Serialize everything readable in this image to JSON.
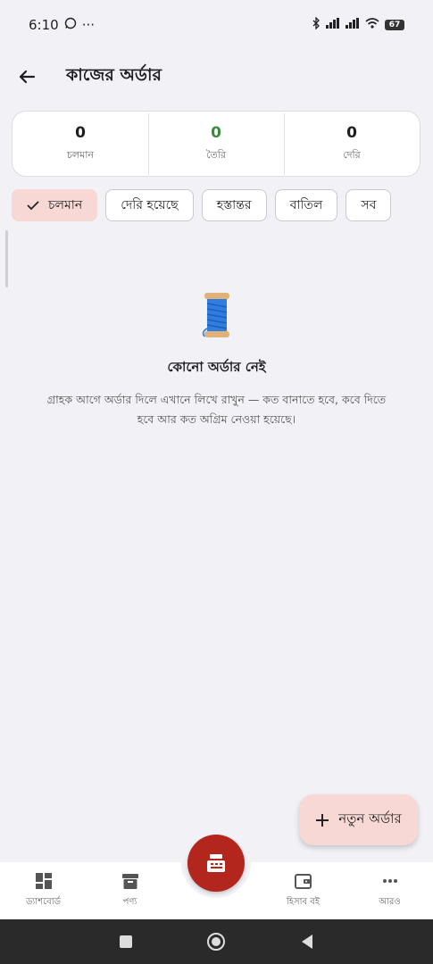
{
  "status_bar": {
    "time": "6:10",
    "more": "···",
    "battery": "67"
  },
  "header": {
    "title": "কাজের অর্ডার"
  },
  "stats": [
    {
      "value": "0",
      "label": "চলমান",
      "color": "#1d1d22"
    },
    {
      "value": "0",
      "label": "তৈরি",
      "color": "#3b8a3e"
    },
    {
      "value": "0",
      "label": "দেরি",
      "color": "#1d1d22"
    }
  ],
  "filters": {
    "selected": "চলমান",
    "chips": [
      "চলমান",
      "দেরি হয়েছে",
      "হস্তান্তর",
      "বাতিল",
      "সব"
    ]
  },
  "empty_state": {
    "icon": "thread-spool-icon",
    "title": "কোনো অর্ডার নেই",
    "description": "গ্রাহক আগে অর্ডার দিলে এখানে লিখে রাখুন — কত বানাতে হবে, কবে দিতে হবে আর কত অগ্রিম নেওয়া হয়েছে।"
  },
  "fab": {
    "label": "নতুন অর্ডার"
  },
  "bottom_nav": {
    "items": [
      "ড্যাশবোর্ড",
      "পণ্য",
      "হিসাব বই",
      "আরও"
    ],
    "center_icon": "cash-register-icon"
  },
  "colors": {
    "accent": "#b3261e",
    "selected_chip": "#f7d8d4",
    "background": "#f1f1f6"
  }
}
